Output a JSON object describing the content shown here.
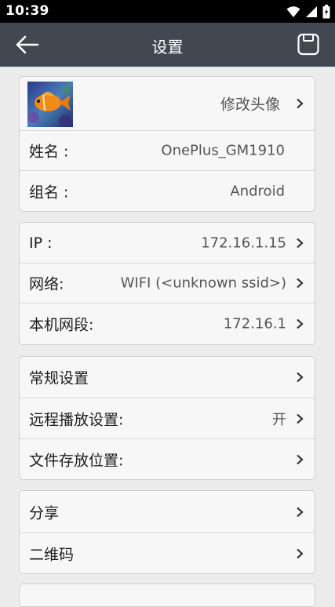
{
  "status_bar": {
    "time": "10:39",
    "icons": [
      "wifi-icon",
      "signal-icon",
      "battery-icon"
    ]
  },
  "app_bar": {
    "title": "设置",
    "back_icon": "arrow-left-icon",
    "save_icon": "save-icon"
  },
  "profile": {
    "edit_avatar_label": "修改头像",
    "name_label": "姓名 :",
    "name_value": "OnePlus_GM1910",
    "group_label": "组名 :",
    "group_value": "Android"
  },
  "network": {
    "ip_label": "IP :",
    "ip_value": "172.16.1.15",
    "net_label": "网络:",
    "net_value": "WIFI (<unknown ssid>)",
    "segment_label": "本机网段:",
    "segment_value": "172.16.1"
  },
  "settings": {
    "general_label": "常规设置",
    "remote_label": "远程播放设置:",
    "remote_value": "开",
    "storage_label": "文件存放位置:"
  },
  "share": {
    "share_label": "分享",
    "qrcode_label": "二维码"
  },
  "colors": {
    "app_bar": "#424852",
    "background": "#ececec",
    "card": "#f7f7f7"
  }
}
